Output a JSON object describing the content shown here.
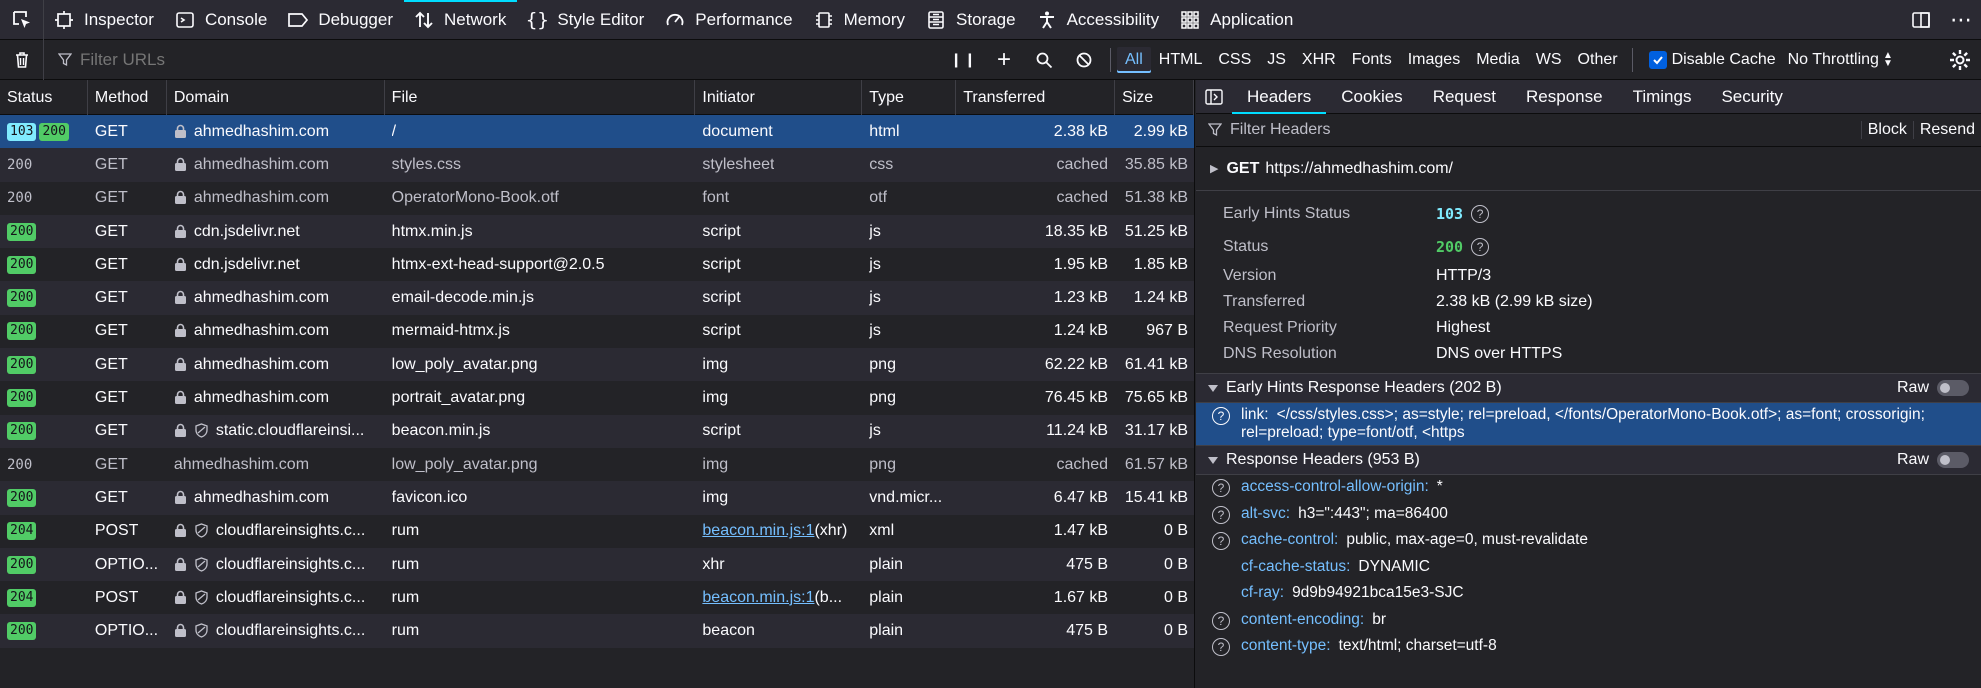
{
  "toolbar": {
    "tabs": [
      {
        "label": "Inspector",
        "icon": "inspector-icon"
      },
      {
        "label": "Console",
        "icon": "console-icon"
      },
      {
        "label": "Debugger",
        "icon": "debugger-icon"
      },
      {
        "label": "Network",
        "icon": "network-icon"
      },
      {
        "label": "Style Editor",
        "icon": "style-editor-icon"
      },
      {
        "label": "Performance",
        "icon": "performance-icon"
      },
      {
        "label": "Memory",
        "icon": "memory-icon"
      },
      {
        "label": "Storage",
        "icon": "storage-icon"
      },
      {
        "label": "Accessibility",
        "icon": "accessibility-icon"
      },
      {
        "label": "Application",
        "icon": "application-icon"
      }
    ],
    "active_tab": "Network"
  },
  "filterbar": {
    "placeholder": "Filter URLs",
    "types": [
      "All",
      "HTML",
      "CSS",
      "JS",
      "XHR",
      "Fonts",
      "Images",
      "Media",
      "WS",
      "Other"
    ],
    "selected_type": "All",
    "disable_cache_label": "Disable Cache",
    "throttling": "No Throttling"
  },
  "table": {
    "columns": [
      "Status",
      "Method",
      "Domain",
      "File",
      "Initiator",
      "Type",
      "Transferred",
      "Size"
    ],
    "rows": [
      {
        "status": [
          "103",
          "200"
        ],
        "method": "GET",
        "domain": "ahmedhashim.com",
        "lock": true,
        "tracker": false,
        "file": "/",
        "initiator": "document",
        "initiator_link": false,
        "initiator_suffix": "",
        "type": "html",
        "transferred": "2.38 kB",
        "size": "2.99 kB",
        "selected": true,
        "cached": false
      },
      {
        "status": [
          "200"
        ],
        "method": "GET",
        "domain": "ahmedhashim.com",
        "lock": true,
        "tracker": false,
        "file": "styles.css",
        "initiator": "stylesheet",
        "initiator_link": false,
        "initiator_suffix": "",
        "type": "css",
        "transferred": "cached",
        "size": "35.85 kB",
        "selected": false,
        "cached": true
      },
      {
        "status": [
          "200"
        ],
        "method": "GET",
        "domain": "ahmedhashim.com",
        "lock": true,
        "tracker": false,
        "file": "OperatorMono-Book.otf",
        "initiator": "font",
        "initiator_link": false,
        "initiator_suffix": "",
        "type": "otf",
        "transferred": "cached",
        "size": "51.38 kB",
        "selected": false,
        "cached": true
      },
      {
        "status": [
          "200"
        ],
        "method": "GET",
        "domain": "cdn.jsdelivr.net",
        "lock": true,
        "tracker": false,
        "file": "htmx.min.js",
        "initiator": "script",
        "initiator_link": false,
        "initiator_suffix": "",
        "type": "js",
        "transferred": "18.35 kB",
        "size": "51.25 kB",
        "selected": false,
        "cached": false
      },
      {
        "status": [
          "200"
        ],
        "method": "GET",
        "domain": "cdn.jsdelivr.net",
        "lock": true,
        "tracker": false,
        "file": "htmx-ext-head-support@2.0.5",
        "initiator": "script",
        "initiator_link": false,
        "initiator_suffix": "",
        "type": "js",
        "transferred": "1.95 kB",
        "size": "1.85 kB",
        "selected": false,
        "cached": false
      },
      {
        "status": [
          "200"
        ],
        "method": "GET",
        "domain": "ahmedhashim.com",
        "lock": true,
        "tracker": false,
        "file": "email-decode.min.js",
        "initiator": "script",
        "initiator_link": false,
        "initiator_suffix": "",
        "type": "js",
        "transferred": "1.23 kB",
        "size": "1.24 kB",
        "selected": false,
        "cached": false
      },
      {
        "status": [
          "200"
        ],
        "method": "GET",
        "domain": "ahmedhashim.com",
        "lock": true,
        "tracker": false,
        "file": "mermaid-htmx.js",
        "initiator": "script",
        "initiator_link": false,
        "initiator_suffix": "",
        "type": "js",
        "transferred": "1.24 kB",
        "size": "967 B",
        "selected": false,
        "cached": false
      },
      {
        "status": [
          "200"
        ],
        "method": "GET",
        "domain": "ahmedhashim.com",
        "lock": true,
        "tracker": false,
        "file": "low_poly_avatar.png",
        "initiator": "img",
        "initiator_link": false,
        "initiator_suffix": "",
        "type": "png",
        "transferred": "62.22 kB",
        "size": "61.41 kB",
        "selected": false,
        "cached": false
      },
      {
        "status": [
          "200"
        ],
        "method": "GET",
        "domain": "ahmedhashim.com",
        "lock": true,
        "tracker": false,
        "file": "portrait_avatar.png",
        "initiator": "img",
        "initiator_link": false,
        "initiator_suffix": "",
        "type": "png",
        "transferred": "76.45 kB",
        "size": "75.65 kB",
        "selected": false,
        "cached": false
      },
      {
        "status": [
          "200"
        ],
        "method": "GET",
        "domain": "static.cloudflareinsi...",
        "lock": true,
        "tracker": true,
        "file": "beacon.min.js",
        "initiator": "script",
        "initiator_link": false,
        "initiator_suffix": "",
        "type": "js",
        "transferred": "11.24 kB",
        "size": "31.17 kB",
        "selected": false,
        "cached": false
      },
      {
        "status": [
          "200"
        ],
        "method": "GET",
        "domain": "ahmedhashim.com",
        "lock": false,
        "tracker": false,
        "file": "low_poly_avatar.png",
        "initiator": "img",
        "initiator_link": false,
        "initiator_suffix": "",
        "type": "png",
        "transferred": "cached",
        "size": "61.57 kB",
        "selected": false,
        "cached": true
      },
      {
        "status": [
          "200"
        ],
        "method": "GET",
        "domain": "ahmedhashim.com",
        "lock": true,
        "tracker": false,
        "file": "favicon.ico",
        "initiator": "img",
        "initiator_link": false,
        "initiator_suffix": "",
        "type": "vnd.micr...",
        "transferred": "6.47 kB",
        "size": "15.41 kB",
        "selected": false,
        "cached": false
      },
      {
        "status": [
          "204"
        ],
        "method": "POST",
        "domain": "cloudflareinsights.c...",
        "lock": true,
        "tracker": true,
        "file": "rum",
        "initiator": "beacon.min.js:1",
        "initiator_link": true,
        "initiator_suffix": " (xhr)",
        "type": "xml",
        "transferred": "1.47 kB",
        "size": "0 B",
        "selected": false,
        "cached": false
      },
      {
        "status": [
          "200"
        ],
        "method": "OPTIO...",
        "domain": "cloudflareinsights.c...",
        "lock": true,
        "tracker": true,
        "file": "rum",
        "initiator": "xhr",
        "initiator_link": false,
        "initiator_suffix": "",
        "type": "plain",
        "transferred": "475 B",
        "size": "0 B",
        "selected": false,
        "cached": false
      },
      {
        "status": [
          "204"
        ],
        "method": "POST",
        "domain": "cloudflareinsights.c...",
        "lock": true,
        "tracker": true,
        "file": "rum",
        "initiator": "beacon.min.js:1",
        "initiator_link": true,
        "initiator_suffix": " (b...",
        "type": "plain",
        "transferred": "1.67 kB",
        "size": "0 B",
        "selected": false,
        "cached": false
      },
      {
        "status": [
          "200"
        ],
        "method": "OPTIO...",
        "domain": "cloudflareinsights.c...",
        "lock": true,
        "tracker": true,
        "file": "rum",
        "initiator": "beacon",
        "initiator_link": false,
        "initiator_suffix": "",
        "type": "plain",
        "transferred": "475 B",
        "size": "0 B",
        "selected": false,
        "cached": false
      }
    ]
  },
  "sidebar": {
    "tabs": [
      "Headers",
      "Cookies",
      "Request",
      "Response",
      "Timings",
      "Security"
    ],
    "active_tab": "Headers",
    "filter_placeholder": "Filter Headers",
    "block_label": "Block",
    "resend_label": "Resend",
    "request_method": "GET",
    "request_url": "https://ahmedhashim.com/",
    "summary": [
      {
        "key": "Early Hints Status",
        "value": "103",
        "style": "status-103",
        "help": true
      },
      {
        "key": "Status",
        "value": "200",
        "style": "status-200",
        "help": true
      },
      {
        "key": "Version",
        "value": "HTTP/3",
        "style": "plain",
        "help": false
      },
      {
        "key": "Transferred",
        "value": "2.38 kB (2.99 kB size)",
        "style": "plain",
        "help": false
      },
      {
        "key": "Request Priority",
        "value": "Highest",
        "style": "plain",
        "help": false
      },
      {
        "key": "DNS Resolution",
        "value": "DNS over HTTPS",
        "style": "plain",
        "help": false
      }
    ],
    "early_hints_section": {
      "title": "Early Hints Response Headers (202 B)",
      "raw_label": "Raw",
      "headers": [
        {
          "name": "link:",
          "value": "</css/styles.css>; as=style; rel=preload, </fonts/OperatorMono-Book.otf>; as=font; crossorigin; rel=preload; type=font/otf, <https",
          "help": true,
          "highlight": true
        }
      ]
    },
    "response_section": {
      "title": "Response Headers (953 B)",
      "raw_label": "Raw",
      "headers": [
        {
          "name": "access-control-allow-origin:",
          "value": "*",
          "help": true
        },
        {
          "name": "alt-svc:",
          "value": "h3=\":443\"; ma=86400",
          "help": true
        },
        {
          "name": "cache-control:",
          "value": "public, max-age=0, must-revalidate",
          "help": true
        },
        {
          "name": "cf-cache-status:",
          "value": "DYNAMIC",
          "help": false
        },
        {
          "name": "cf-ray:",
          "value": "9d9b94921bca15e3-SJC",
          "help": false
        },
        {
          "name": "content-encoding:",
          "value": "br",
          "help": true
        },
        {
          "name": "content-type:",
          "value": "text/html; charset=utf-8",
          "help": true
        }
      ]
    }
  },
  "colors": {
    "accent": "#00ddff",
    "link": "#75bfff",
    "status_2xx": "#51cb66",
    "status_103": "#80ebff",
    "selected_row": "#204e8a"
  }
}
